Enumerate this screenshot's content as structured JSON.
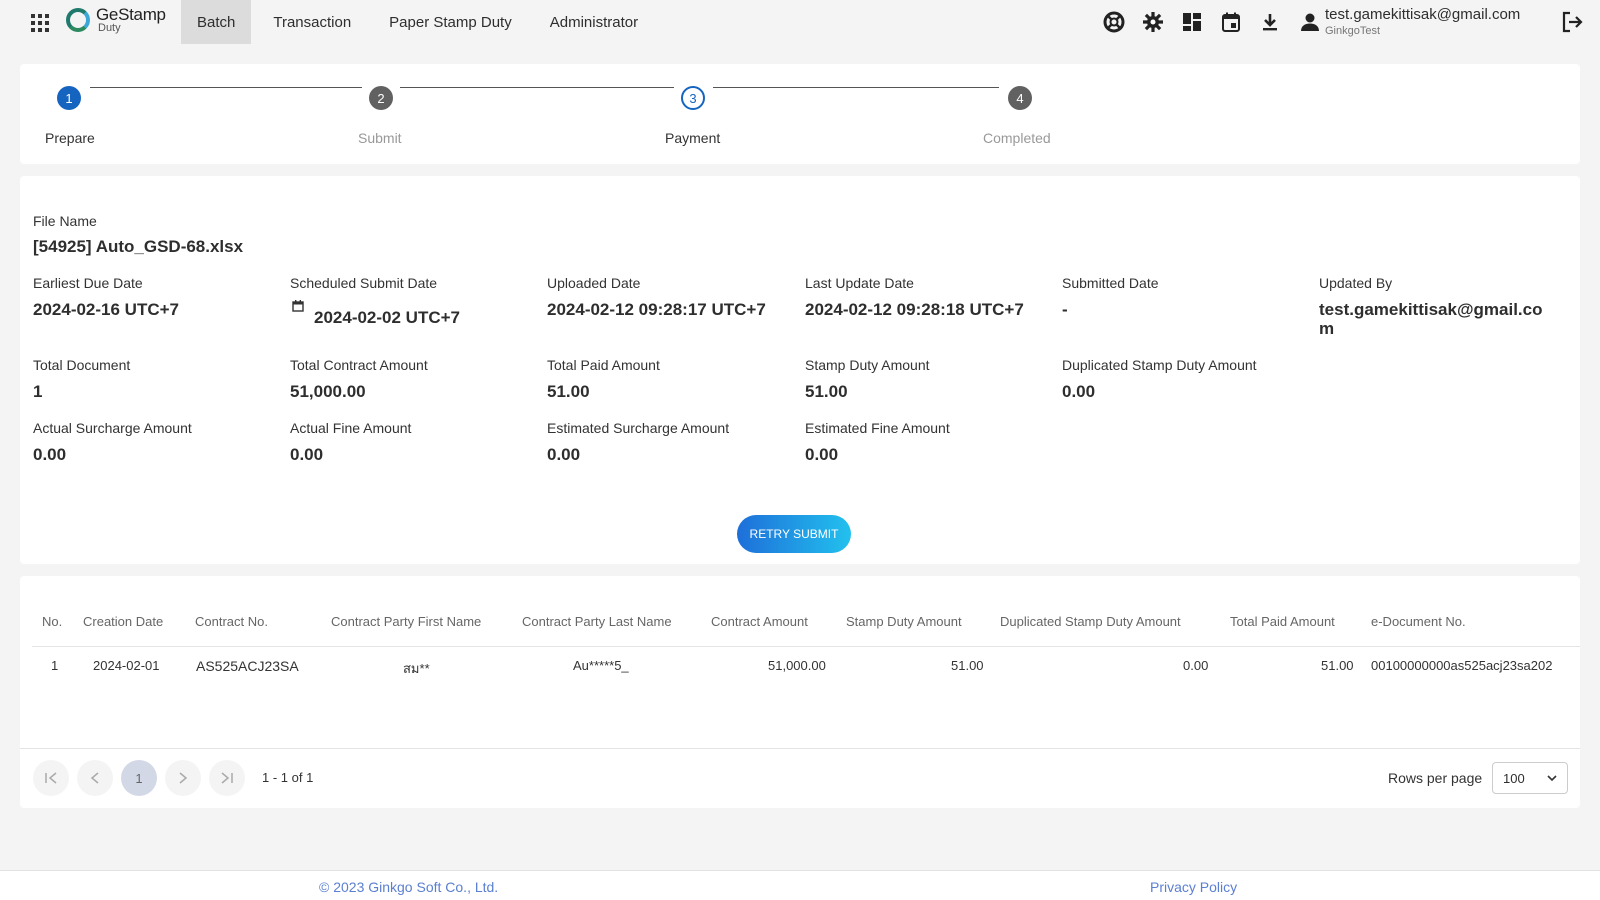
{
  "app": {
    "brand_main": "GeStamp",
    "brand_sub": "Duty",
    "nav": [
      {
        "label": "Batch",
        "active": true
      },
      {
        "label": "Transaction",
        "active": false
      },
      {
        "label": "Paper Stamp Duty",
        "active": false
      },
      {
        "label": "Administrator",
        "active": false
      }
    ],
    "user": {
      "email": "test.gamekittisak@gmail.com",
      "org": "GinkgoTest"
    }
  },
  "stepper": {
    "steps": [
      {
        "number": "1",
        "label": "Prepare",
        "state": "done"
      },
      {
        "number": "2",
        "label": "Submit",
        "state": "inactive"
      },
      {
        "number": "3",
        "label": "Payment",
        "state": "current"
      },
      {
        "number": "4",
        "label": "Completed",
        "state": "inactive"
      }
    ]
  },
  "batch": {
    "file_name_label": "File Name",
    "file_name": "[54925] Auto_GSD-68.xlsx",
    "fields": {
      "earliest_due": {
        "label": "Earliest Due Date",
        "value": "2024-02-16 UTC+7"
      },
      "scheduled_submit": {
        "label": "Scheduled Submit Date",
        "value": "2024-02-02 UTC+7"
      },
      "uploaded": {
        "label": "Uploaded Date",
        "value": "2024-02-12 09:28:17 UTC+7"
      },
      "last_update": {
        "label": "Last Update Date",
        "value": "2024-02-12 09:28:18 UTC+7"
      },
      "submitted": {
        "label": "Submitted Date",
        "value": "-"
      },
      "updated_by": {
        "label": "Updated By",
        "value_line1": "test.gamekittisak@gmail.co",
        "value_line2": "m"
      },
      "total_document": {
        "label": "Total Document",
        "value": "1"
      },
      "total_contract": {
        "label": "Total Contract Amount",
        "value": "51,000.00"
      },
      "total_paid": {
        "label": "Total Paid Amount",
        "value": "51.00"
      },
      "stamp_duty": {
        "label": "Stamp Duty Amount",
        "value": "51.00"
      },
      "dup_stamp_duty": {
        "label": "Duplicated Stamp Duty Amount",
        "value": "0.00"
      },
      "actual_surcharge": {
        "label": "Actual Surcharge Amount",
        "value": "0.00"
      },
      "actual_fine": {
        "label": "Actual Fine Amount",
        "value": "0.00"
      },
      "est_surcharge": {
        "label": "Estimated Surcharge Amount",
        "value": "0.00"
      },
      "est_fine": {
        "label": "Estimated Fine Amount",
        "value": "0.00"
      }
    },
    "retry_label": "RETRY SUBMIT"
  },
  "table": {
    "columns": [
      "No.",
      "Creation Date",
      "Contract No.",
      "Contract Party First Name",
      "Contract Party Last Name",
      "Contract Amount",
      "Stamp Duty Amount",
      "Duplicated Stamp Duty Amount",
      "Total Paid Amount",
      "e-Document No."
    ],
    "rows": [
      [
        "1",
        "2024-02-01",
        "AS525ACJ23SA",
        "สม**",
        "Au*****5_",
        "51,000.00",
        "51.00",
        "0.00",
        "51.00",
        "00100000000as525acj23sa202"
      ]
    ],
    "pager": {
      "current": "1",
      "range": "1 - 1 of 1"
    },
    "rows_per_page_label": "Rows per page",
    "rows_per_page": "100"
  },
  "footer": {
    "copyright": "© 2023 Ginkgo Soft Co., Ltd.",
    "privacy": "Privacy Policy"
  },
  "colors": {
    "accent": "#1565c0",
    "inactive_step": "#616161",
    "button_gradient_start": "#1e6fd9",
    "button_gradient_end": "#22c1ee"
  }
}
